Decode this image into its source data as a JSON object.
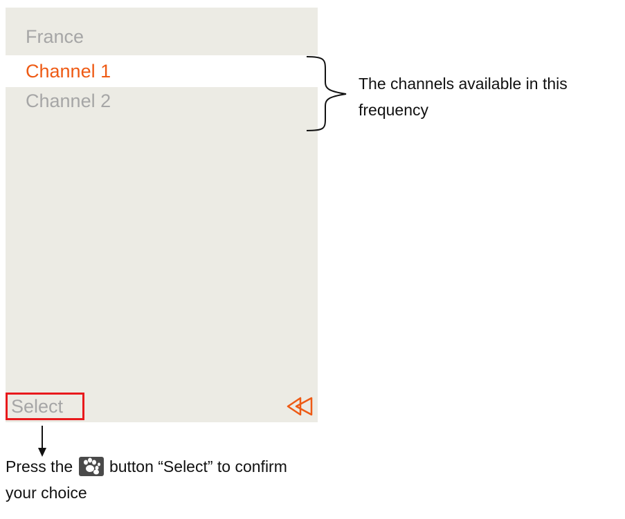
{
  "screen": {
    "header": "France",
    "items": [
      {
        "label": "Channel 1",
        "selected": true
      },
      {
        "label": "Channel 2",
        "selected": false
      }
    ],
    "softkey_left": "Select",
    "softkey_right_icon": "double-left-arrow-icon",
    "colors": {
      "background": "#ecebe4",
      "selected_row": "#ffffff",
      "accent": "#ee5a14",
      "inactive_text": "#a6a6a6",
      "highlight_box": "#e8191c"
    }
  },
  "annotations": {
    "channels_note": "The channels available in this frequency",
    "press_prefix": "Press the",
    "press_suffix": "button “Select” to confirm your choice",
    "paw_icon": "paw-button-icon"
  }
}
